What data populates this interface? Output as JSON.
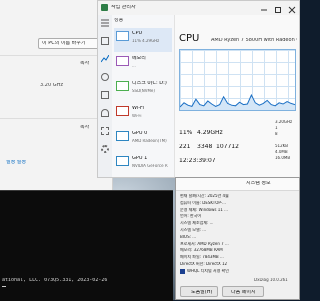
{
  "settings": {
    "rename_button": "이 PC의 이름 바꾸기",
    "copy_label_1": "복사",
    "speed": "3.20 GHz",
    "copy_label_2": "복사",
    "link_settings": "설정 설정"
  },
  "taskmgr": {
    "title": "작업 관리자",
    "header": "성능",
    "items": [
      {
        "name": "CPU",
        "sub": "11% 4.29GHz"
      },
      {
        "name": "메모리",
        "sub": "..."
      },
      {
        "name": "디스크 0(C: D:)",
        "sub": "SSD(NVMe)"
      },
      {
        "name": "Wi-Fi",
        "sub": "Wi-Fi"
      },
      {
        "name": "GPU 0",
        "sub": "AMD Radeon(TM)"
      },
      {
        "name": "GPU 1",
        "sub": "NVIDIA GeForce R"
      }
    ],
    "main": {
      "title": "CPU",
      "model": "AMD Ryzen 7 5800H with Radeon Graphics",
      "usage": "11%",
      "speed": "4.29GHz",
      "processes": "221",
      "threads": "3348",
      "handles": "107712",
      "uptime": "12:23:39:07",
      "base_speed": "3.20GHz",
      "sockets": "1",
      "cores": "8",
      "l1": "512KB",
      "l2": "4.0MB",
      "l3": "16.0MB"
    },
    "cpu_util_percent": [
      5,
      12,
      8,
      6,
      18,
      9,
      7,
      15,
      10,
      6,
      9,
      22,
      11,
      8,
      7,
      13,
      9,
      10,
      25,
      12,
      8,
      11,
      16,
      9,
      7,
      12,
      10,
      14,
      11,
      9
    ]
  },
  "sysinfo": {
    "title": "시스템 정보",
    "rows": [
      "현재 날짜/시간: 2025년 4월",
      "컴퓨터 이름: DESKTOP-...",
      "운영 체제: Windows 11 ...",
      "언어: 한국어",
      "시스템 제조업체: ...",
      "시스템 모델: ...",
      "BIOS: ...",
      "프로세서: AMD Ryzen 7 ...",
      "메모리: 32768MB RAM",
      "페이지 파일: 7843MB ...",
      "DirectX 버전: DirectX 12"
    ],
    "checkbox_label": "WHQL 디지털 서명 확인",
    "footer": "DxDiag 10.0.261",
    "btn_help": "도움말(H)",
    "btn_next": "다음 페이지"
  },
  "terminal": {
    "line": "ational, LLC. 073Q5.331, 2023-02-26"
  },
  "colors": {
    "accent": "#0067c0",
    "cpu_line": "#1a6fc4",
    "cpu_fill": "#d4e6f7"
  }
}
